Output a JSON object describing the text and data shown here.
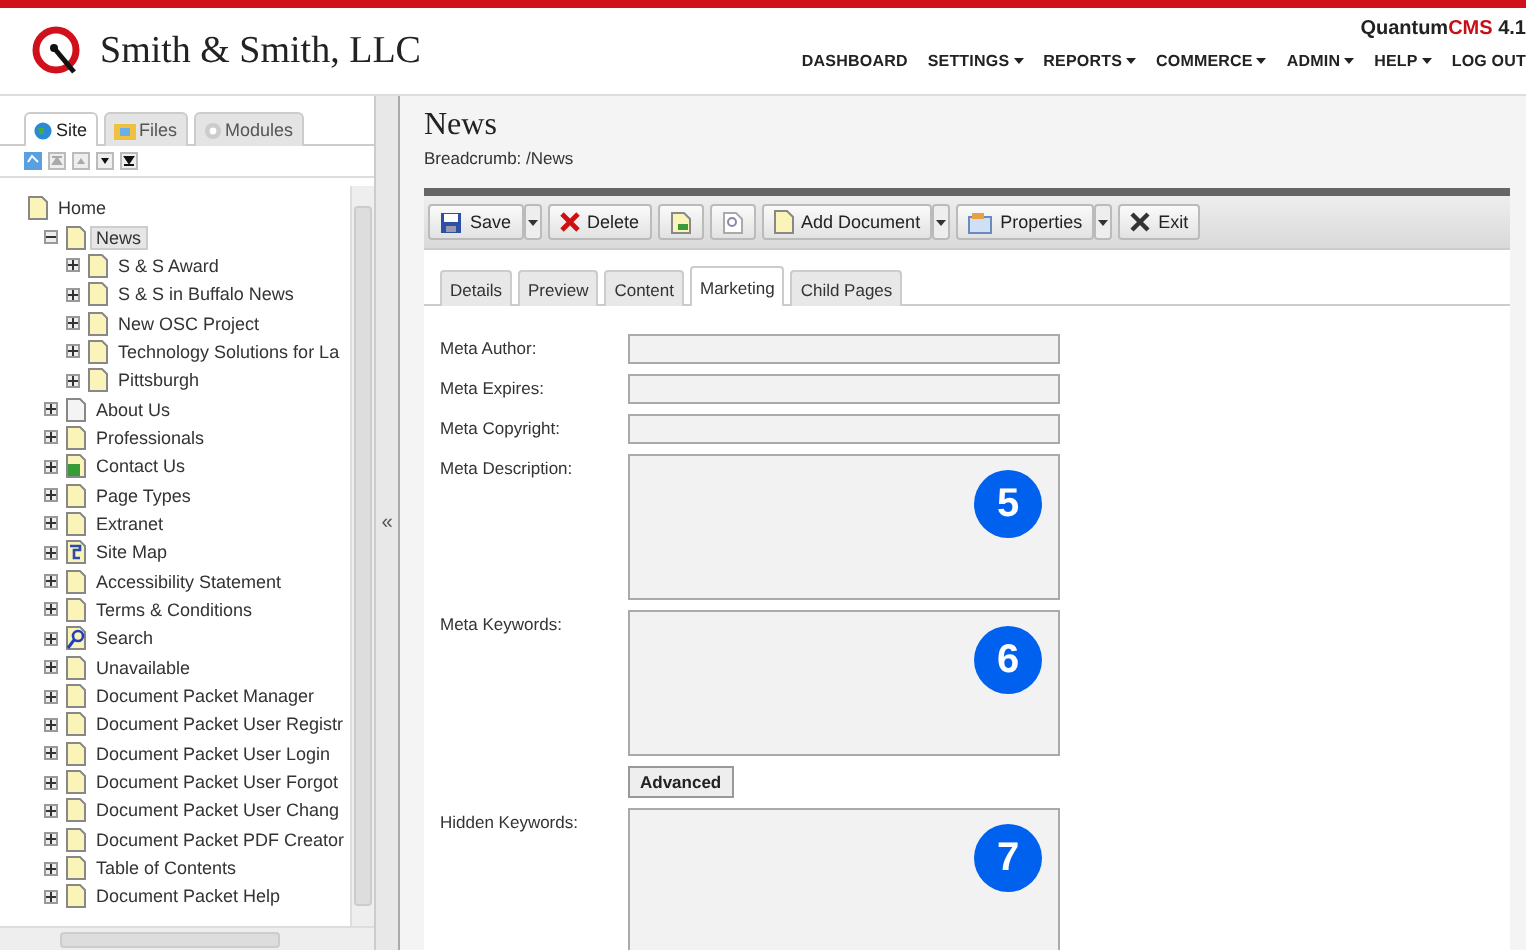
{
  "header": {
    "company": "Smith & Smith, LLC",
    "product": {
      "name_a": "Quantum",
      "name_b": "CMS",
      "version": "4.1"
    },
    "nav": [
      {
        "label": "DASHBOARD",
        "has_menu": false
      },
      {
        "label": "SETTINGS",
        "has_menu": true
      },
      {
        "label": "REPORTS",
        "has_menu": true
      },
      {
        "label": "COMMERCE",
        "has_menu": true
      },
      {
        "label": "ADMIN",
        "has_menu": true
      },
      {
        "label": "HELP",
        "has_menu": true
      },
      {
        "label": "LOG OUT",
        "has_menu": false
      }
    ]
  },
  "sidebar": {
    "tabs": [
      {
        "label": "Site",
        "selected": true
      },
      {
        "label": "Files",
        "selected": false
      },
      {
        "label": "Modules",
        "selected": false
      }
    ],
    "tree": [
      {
        "label": "Home",
        "kind": "page",
        "selected": false,
        "children": [
          {
            "label": "News",
            "kind": "page",
            "expanded": true,
            "selected": true,
            "children": [
              {
                "label": "S & S Award",
                "kind": "page",
                "expanded": false,
                "selected": false
              },
              {
                "label": "S & S in Buffalo News",
                "kind": "page",
                "expanded": false,
                "selected": false
              },
              {
                "label": "New OSC Project",
                "kind": "page",
                "expanded": false,
                "selected": false
              },
              {
                "label": "Technology Solutions for La",
                "kind": "page",
                "expanded": false,
                "selected": false
              },
              {
                "label": "Pittsburgh",
                "kind": "page",
                "expanded": false,
                "selected": false
              }
            ]
          },
          {
            "label": "About Us",
            "kind": "blank",
            "expanded": false,
            "selected": false
          },
          {
            "label": "Professionals",
            "kind": "page",
            "expanded": false,
            "selected": false
          },
          {
            "label": "Contact Us",
            "kind": "contact",
            "expanded": false,
            "selected": false
          },
          {
            "label": "Page Types",
            "kind": "page",
            "expanded": false,
            "selected": false
          },
          {
            "label": "Extranet",
            "kind": "page",
            "expanded": false,
            "selected": false
          },
          {
            "label": "Site Map",
            "kind": "sitemap",
            "expanded": false,
            "selected": false
          },
          {
            "label": "Accessibility Statement",
            "kind": "page",
            "expanded": false,
            "selected": false
          },
          {
            "label": "Terms & Conditions",
            "kind": "page",
            "expanded": false,
            "selected": false
          },
          {
            "label": "Search",
            "kind": "search",
            "expanded": false,
            "selected": false
          },
          {
            "label": "Unavailable",
            "kind": "page",
            "expanded": false,
            "selected": false
          },
          {
            "label": "Document Packet Manager",
            "kind": "page",
            "expanded": false,
            "selected": false
          },
          {
            "label": "Document Packet User Registr",
            "kind": "page",
            "expanded": false,
            "selected": false
          },
          {
            "label": "Document Packet User Login",
            "kind": "page",
            "expanded": false,
            "selected": false
          },
          {
            "label": "Document Packet User Forgot",
            "kind": "page",
            "expanded": false,
            "selected": false
          },
          {
            "label": "Document Packet User Chang",
            "kind": "page",
            "expanded": false,
            "selected": false
          },
          {
            "label": "Document Packet PDF Creator",
            "kind": "page",
            "expanded": false,
            "selected": false
          },
          {
            "label": "Table of Contents",
            "kind": "page",
            "expanded": false,
            "selected": false
          },
          {
            "label": "Document Packet Help",
            "kind": "page",
            "expanded": false,
            "selected": false
          }
        ]
      }
    ]
  },
  "splitter": "«",
  "page": {
    "title": "News",
    "breadcrumb": "Breadcrumb: /News",
    "toolbar": [
      {
        "kind": "button",
        "label": "Save",
        "split": true
      },
      {
        "kind": "button",
        "label": "Delete",
        "split": false
      },
      {
        "kind": "icon",
        "split": false
      },
      {
        "kind": "icon",
        "split": false
      },
      {
        "kind": "button",
        "label": "Add Document",
        "split": true
      },
      {
        "kind": "button",
        "label": "Properties",
        "split": true
      },
      {
        "kind": "button",
        "label": "Exit",
        "split": false
      }
    ],
    "tabs": [
      {
        "label": "Details",
        "selected": false
      },
      {
        "label": "Preview",
        "selected": false
      },
      {
        "label": "Content",
        "selected": false
      },
      {
        "label": "Marketing",
        "selected": true
      },
      {
        "label": "Child Pages",
        "selected": false
      }
    ],
    "fields": [
      {
        "kind": "input",
        "label": "Meta Author:"
      },
      {
        "kind": "input",
        "label": "Meta Expires:"
      },
      {
        "kind": "input",
        "label": "Meta Copyright:"
      },
      {
        "kind": "textarea",
        "label": "Meta Description:",
        "marker": "5"
      },
      {
        "kind": "textarea",
        "label": "Meta Keywords:",
        "marker": "6"
      },
      {
        "kind": "button",
        "label": "Advanced"
      },
      {
        "kind": "textarea",
        "label": "Hidden Keywords:",
        "marker": "7"
      }
    ]
  }
}
